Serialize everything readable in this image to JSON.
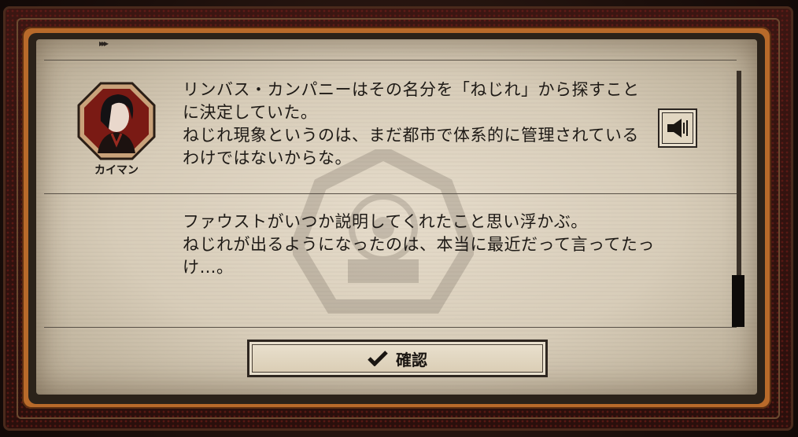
{
  "log": {
    "entries": [
      {
        "speaker": "カイマン",
        "text": "リンバス・カンパニーはその名分を「ねじれ」から探すことに決定していた。\nねじれ現象というのは、まだ都市で体系的に管理されているわけではないからな。"
      },
      {
        "speaker": "",
        "text": "ファウストがいつか説明してくれたこと思い浮かぶ。\nねじれが出るようになったのは、本当に最近だって言ってたっけ…。"
      }
    ]
  },
  "buttons": {
    "confirm_label": "確認",
    "confirm_icon": "checkmark-icon",
    "voice_icon": "speaker-icon"
  },
  "colors": {
    "paper": "#d8cdb9",
    "frame_orange": "#b86a2a",
    "frame_red": "#3b1612",
    "text": "#1e1a16"
  }
}
